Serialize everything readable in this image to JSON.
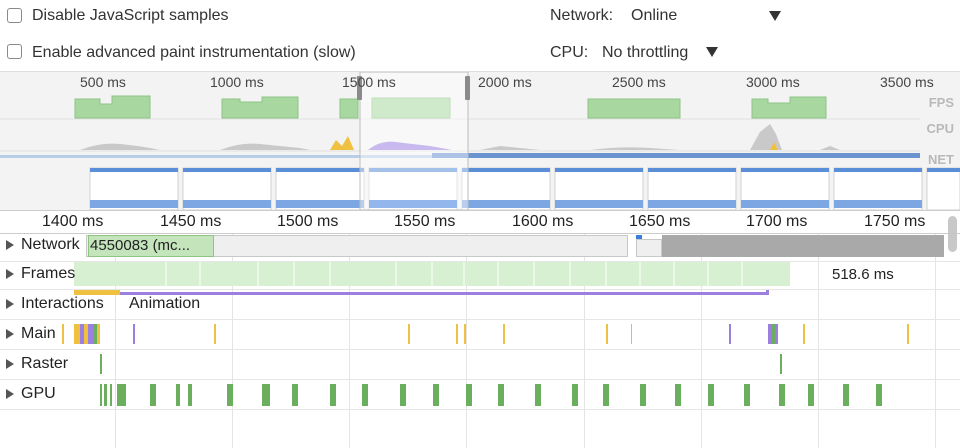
{
  "settings": {
    "disable_js_samples": "Disable JavaScript samples",
    "enable_paint": "Enable advanced paint instrumentation (slow)",
    "network_label": "Network:",
    "network_value": "Online",
    "cpu_label": "CPU:",
    "cpu_value": "No throttling"
  },
  "overview": {
    "ticks": [
      "500 ms",
      "1000 ms",
      "1500 ms",
      "2000 ms",
      "2500 ms",
      "3000 ms",
      "3500 ms"
    ],
    "rows": [
      "FPS",
      "CPU",
      "NET"
    ]
  },
  "ruler": {
    "ticks": [
      "1400 ms",
      "1450 ms",
      "1500 ms",
      "1550 ms",
      "1600 ms",
      "1650 ms",
      "1700 ms",
      "1750 ms"
    ]
  },
  "tracks": {
    "network": "Network",
    "network_request": "4550083 (mc...",
    "frames": "Frames",
    "frame_duration": "518.6 ms",
    "interactions": "Interactions",
    "animation": "Animation",
    "main": "Main",
    "raster": "Raster",
    "gpu": "GPU"
  },
  "colors": {
    "fps_green": "#a8d8a0",
    "frame_green": "#d7f0d1",
    "gpu_green": "#6aae5e",
    "selection_blue": "#3b7ddd",
    "interaction_purple": "#9b80e0",
    "script_yellow": "#f0c040"
  }
}
